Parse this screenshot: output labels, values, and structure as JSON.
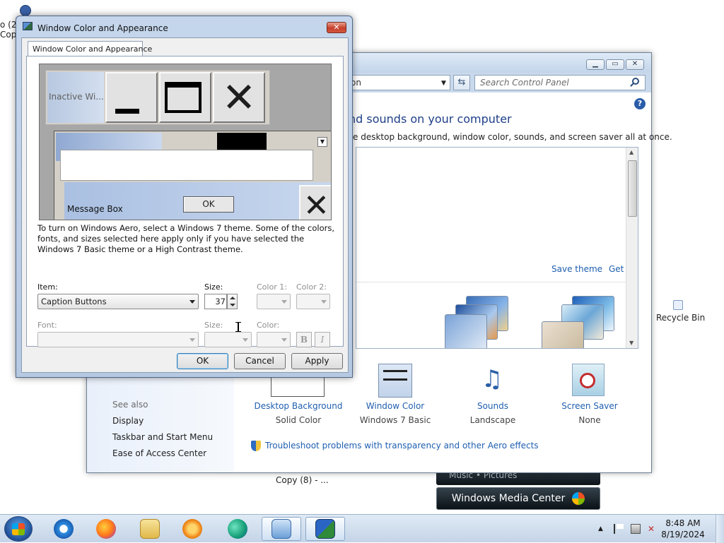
{
  "desktop": {
    "left_text_lines": [
      "o (2",
      "Cop"
    ],
    "recycle_bin_label": "Recycle Bin",
    "copy_label": "Copy (8) - ...",
    "media_small_label": "Music • Pictures",
    "media_center_label": "Windows Media Center"
  },
  "control_panel": {
    "address_text": "on",
    "search_placeholder": "Search Control Panel",
    "heading": "nd sounds on your computer",
    "description": "e desktop background, window color, sounds, and screen saver all at once.",
    "save_theme": "Save theme",
    "get_more_themes": "Get more themes online",
    "bottom_items": [
      {
        "label": "Desktop Background",
        "sub": "Solid Color"
      },
      {
        "label": "Window Color",
        "sub": "Windows 7 Basic"
      },
      {
        "label": "Sounds",
        "sub": "Landscape"
      },
      {
        "label": "Screen Saver",
        "sub": "None"
      }
    ],
    "see_also": {
      "heading": "See also",
      "links": [
        "Display",
        "Taskbar and Start Menu",
        "Ease of Access Center"
      ]
    },
    "troubleshoot_link": "Troubleshoot problems with transparency and other Aero effects"
  },
  "dialog": {
    "title": "Window Color and Appearance",
    "tab_label": "Window Color and Appearance",
    "close_glyph": "✕",
    "preview": {
      "inactive_title": "Inactive Wi...",
      "message_box_title": "Message Box",
      "ok_label": "OK"
    },
    "aero_note": "To turn on Windows Aero, select a Windows 7 theme.  Some of the colors, fonts, and sizes selected here apply only if you have selected the Windows 7 Basic theme or a High Contrast theme.",
    "labels": {
      "item": "Item:",
      "size": "Size:",
      "color1": "Color 1:",
      "color2": "Color 2:",
      "font": "Font:",
      "font_size": "Size:",
      "font_color": "Color:"
    },
    "item_value": "Caption Buttons",
    "size_value": "37",
    "bold_label": "B",
    "italic_label": "I",
    "buttons": {
      "ok": "OK",
      "cancel": "Cancel",
      "apply": "Apply"
    }
  },
  "taskbar": {
    "time": "8:48 AM",
    "date": "8/19/2024",
    "apps": [
      "internet-explorer",
      "firefox",
      "file-explorer",
      "media-player",
      "edge-like",
      "control-panel",
      "display-settings"
    ]
  },
  "colors": {
    "link_blue": "#1f5fb0",
    "heading_blue": "#1e3f87",
    "dialog_frame": "#c5d6ec",
    "close_red": "#c6402b"
  }
}
